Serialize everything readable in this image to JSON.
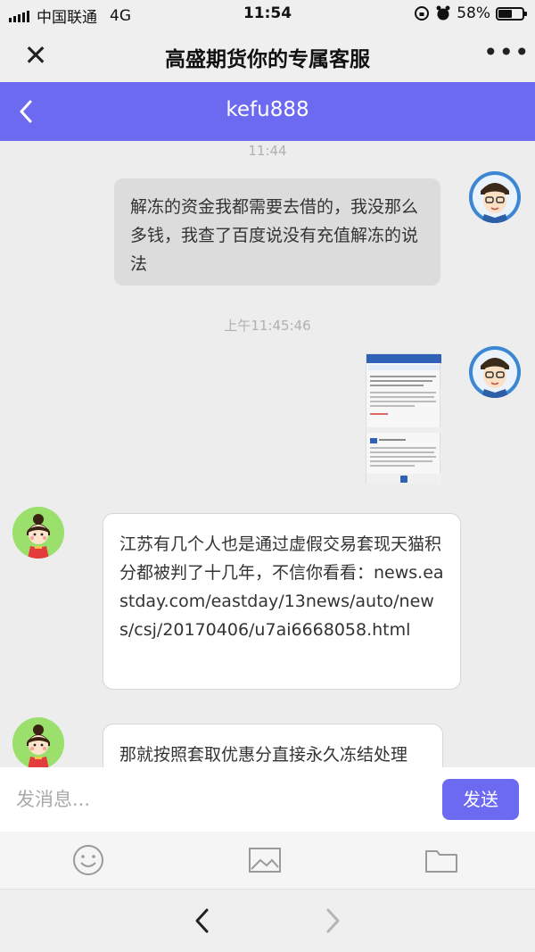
{
  "status": {
    "carrier": "中国联通",
    "network": "4G",
    "time": "11:54",
    "battery": "58%"
  },
  "titlebar": {
    "title": "高盛期货你的专属客服",
    "close_icon": "close-icon",
    "more_icon": "more-icon"
  },
  "chat_header": {
    "name": "kefu888",
    "back_icon": "chevron-left-icon"
  },
  "messages": [
    {
      "stamp": "11:44"
    },
    {
      "side": "right",
      "text": "解冻的资金我都需要去借的，我没那么多钱，我查了百度说没有充值解冻的说法"
    },
    {
      "stamp": "上午11:45:46"
    },
    {
      "side": "right",
      "type": "image",
      "icon": "screenshot-thumbnail"
    },
    {
      "side": "left",
      "text": "江苏有几个人也是通过虚假交易套现天猫积分都被判了十几年，不信你看看：news.eastday.com/eastday/13news/auto/news/csj/20170406/u7ai6668058.html"
    },
    {
      "side": "left",
      "text": "那就按照套取优惠分直接永久冻结处理"
    }
  ],
  "input": {
    "placeholder": "发消息...",
    "send_label": "发送"
  },
  "tools": [
    "emoji-icon",
    "image-icon",
    "folder-icon"
  ],
  "nav": [
    "back-icon",
    "forward-icon"
  ],
  "colors": {
    "accent": "#6c6af0"
  }
}
